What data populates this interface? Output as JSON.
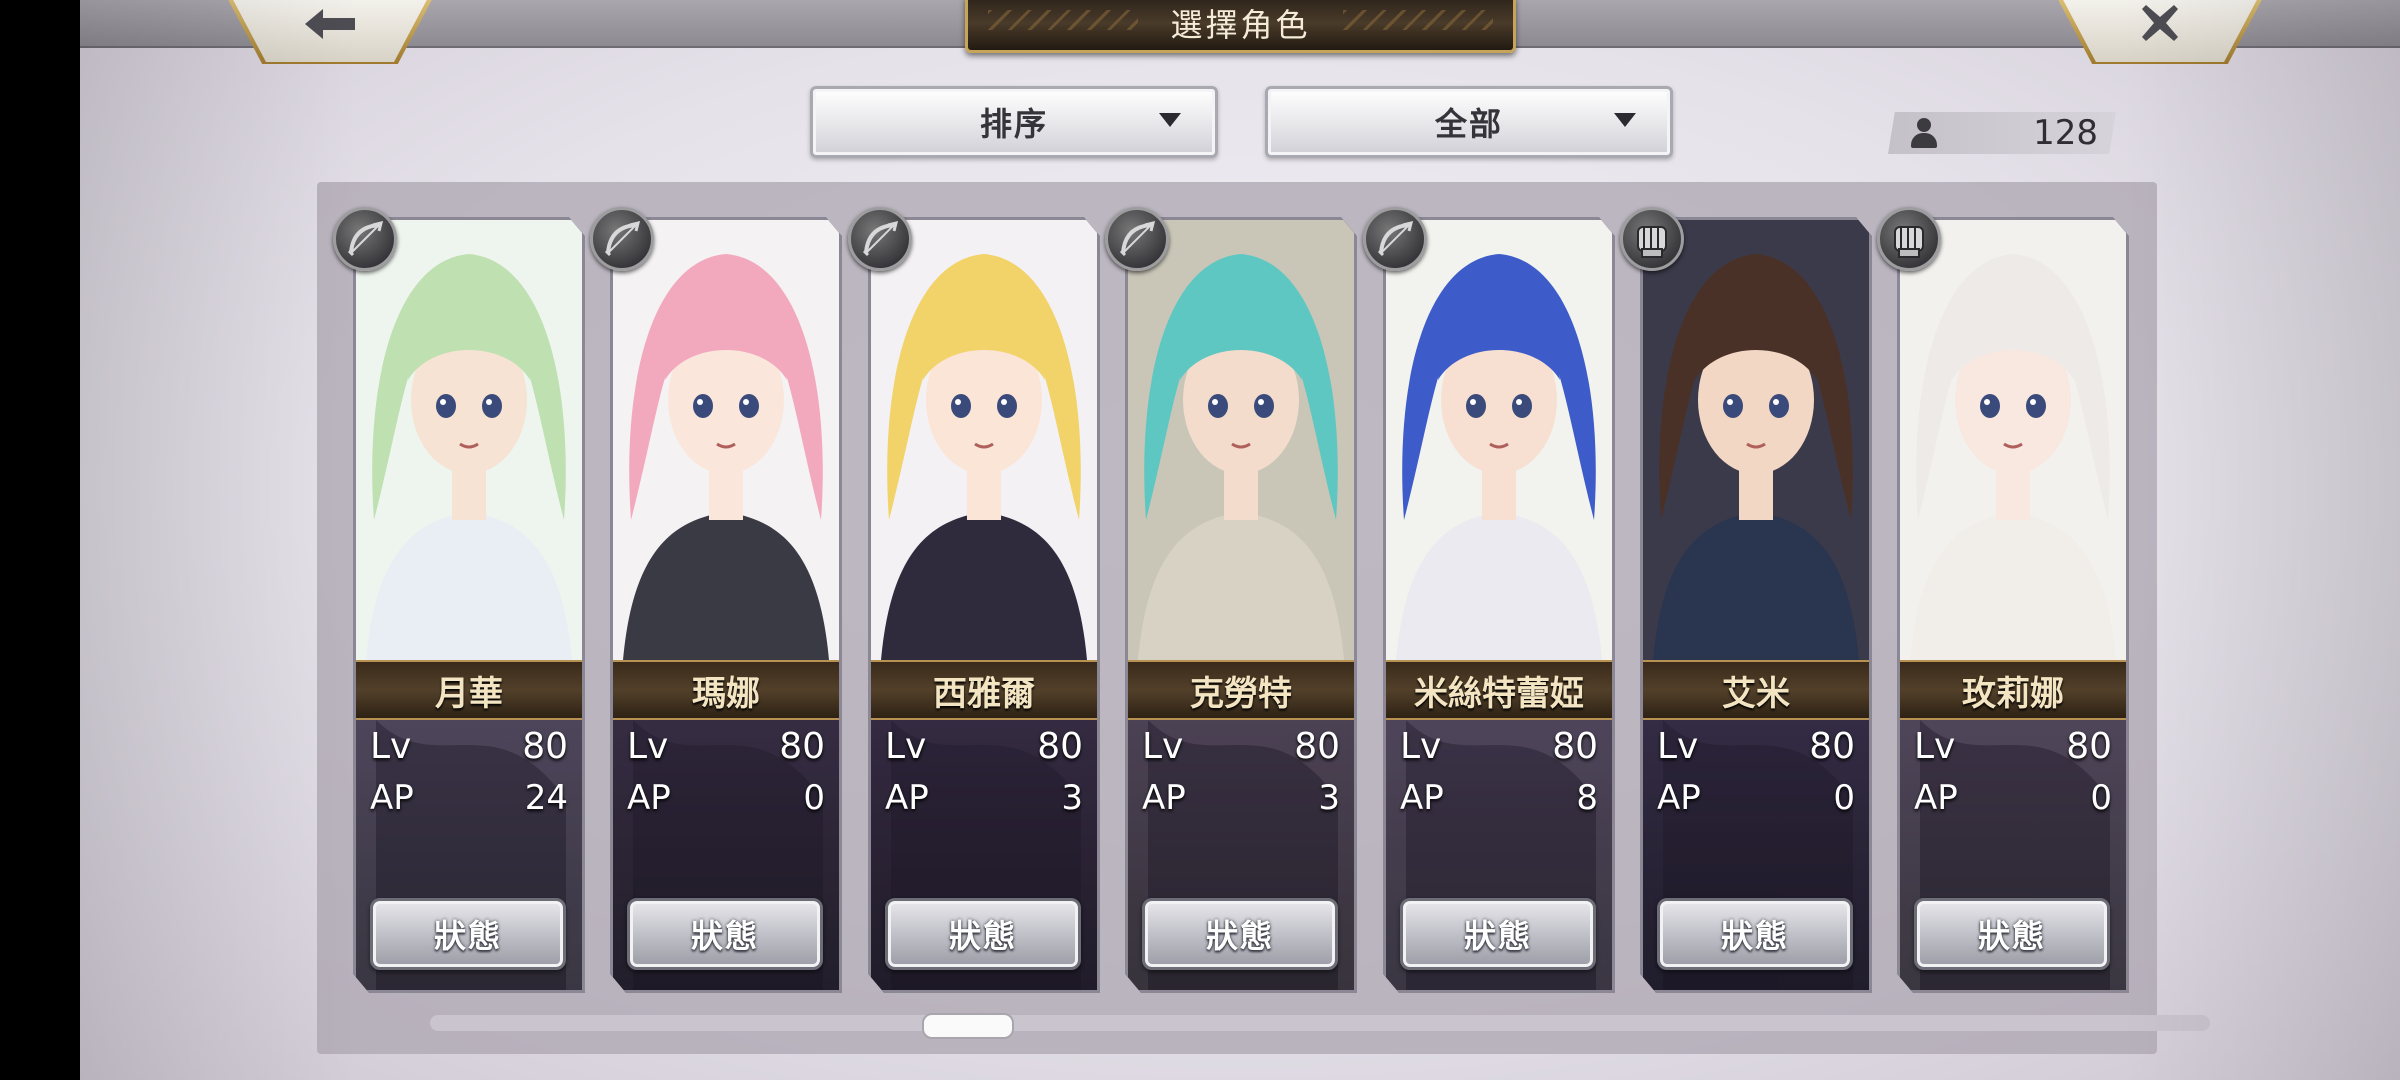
{
  "header": {
    "title": "選擇角色",
    "back_icon": "arrow-left-icon",
    "close_icon": "close-icon"
  },
  "controls": {
    "sort_label": "排序",
    "filter_label": "全部",
    "character_count": "128"
  },
  "characters": [
    {
      "name": "月華",
      "lv_label": "Lv",
      "lv": "80",
      "ap_label": "AP",
      "ap": "24",
      "class": "bow",
      "status_label": "狀態",
      "hair": "#bfe0b0",
      "skin": "#f7e3d3",
      "outfit": "#e9eef4",
      "bg": "#eef4ee"
    },
    {
      "name": "瑪娜",
      "lv_label": "Lv",
      "lv": "80",
      "ap_label": "AP",
      "ap": "0",
      "class": "bow",
      "status_label": "狀態",
      "hair": "#f2a9be",
      "skin": "#fbe6dc",
      "outfit": "#3a3a44",
      "bg": "#f5f2f4"
    },
    {
      "name": "西雅爾",
      "lv_label": "Lv",
      "lv": "80",
      "ap_label": "AP",
      "ap": "3",
      "class": "bow",
      "status_label": "狀態",
      "hair": "#f1d36a",
      "skin": "#fbe5d6",
      "outfit": "#2f2a3c",
      "bg": "#f4f1f4"
    },
    {
      "name": "克勞特",
      "lv_label": "Lv",
      "lv": "80",
      "ap_label": "AP",
      "ap": "3",
      "class": "bow",
      "status_label": "狀態",
      "hair": "#5fc7c2",
      "skin": "#f3dccb",
      "outfit": "#d8d2c4",
      "bg": "#c9c6b8"
    },
    {
      "name": "米絲特蕾婭",
      "lv_label": "Lv",
      "lv": "80",
      "ap_label": "AP",
      "ap": "8",
      "class": "bow",
      "status_label": "狀態",
      "hair": "#3d5cc9",
      "skin": "#f7e0d2",
      "outfit": "#eaeaf0",
      "bg": "#f2f2ee"
    },
    {
      "name": "艾米",
      "lv_label": "Lv",
      "lv": "80",
      "ap_label": "AP",
      "ap": "0",
      "class": "fist",
      "status_label": "狀態",
      "hair": "#4a3128",
      "skin": "#f2d7c4",
      "outfit": "#2a3550",
      "bg": "#3b3a4a"
    },
    {
      "name": "玫莉娜",
      "lv_label": "Lv",
      "lv": "80",
      "ap_label": "AP",
      "ap": "0",
      "class": "fist",
      "status_label": "狀態",
      "hair": "#eeeae8",
      "skin": "#f8e8df",
      "outfit": "#f1eee9",
      "bg": "#f3f1ee"
    }
  ],
  "theme": {
    "accent_gold": "#c6a45a",
    "card_dark": "#2b2338",
    "name_text": "#f3e4c2"
  }
}
